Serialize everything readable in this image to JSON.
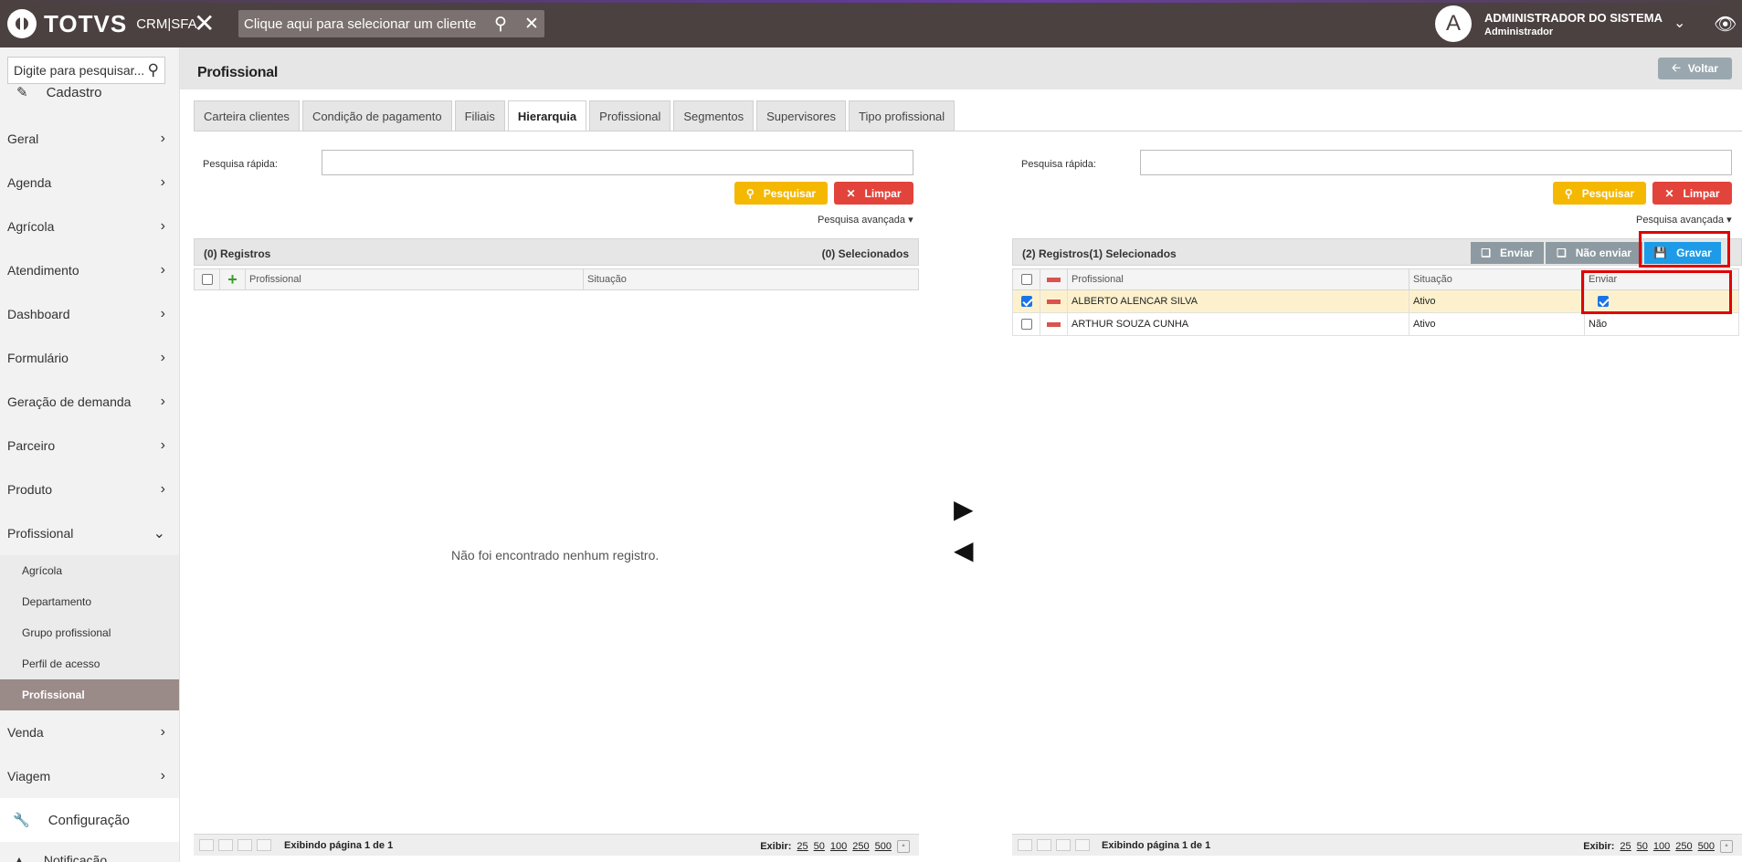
{
  "topbar": {
    "brand": "TOTVS",
    "brand_sub": "CRM|SFA",
    "client_placeholder": "Clique aqui para selecionar um cliente",
    "user_initial": "A",
    "user_name": "ADMINISTRADOR DO SISTEMA",
    "user_role": "Administrador"
  },
  "sidebar": {
    "search_placeholder": "Digite para pesquisar...",
    "cadastro": "Cadastro",
    "items": [
      "Geral",
      "Agenda",
      "Agrícola",
      "Atendimento",
      "Dashboard",
      "Formulário",
      "Geração de demanda",
      "Parceiro",
      "Produto"
    ],
    "expanded": "Profissional",
    "subitems": [
      "Agrícola",
      "Departamento",
      "Grupo profissional",
      "Perfil de acesso",
      "Profissional"
    ],
    "active_subitem": "Profissional",
    "after_items": [
      "Venda",
      "Viagem"
    ],
    "config": "Configuração",
    "notif": "Notificação"
  },
  "page": {
    "title": "Profissional",
    "back_label": "Voltar",
    "tabs": [
      "Carteira clientes",
      "Condição de pagamento",
      "Filiais",
      "Hierarquia",
      "Profissional",
      "Segmentos",
      "Supervisores",
      "Tipo profissional"
    ],
    "active_tab": "Hierarquia"
  },
  "left": {
    "quick_search_label": "Pesquisa rápida:",
    "search_btn": "Pesquisar",
    "clear_btn": "Limpar",
    "advanced": "Pesquisa avançada",
    "header_left": "(0) Registros",
    "header_right": "(0) Selecionados",
    "columns": [
      "Profissional",
      "Situação"
    ],
    "empty": "Não foi encontrado nenhum registro.",
    "footer_page": "Exibindo página 1 de 1",
    "footer_show": "Exibir:",
    "page_sizes": [
      "25",
      "50",
      "100",
      "250",
      "500"
    ]
  },
  "right": {
    "quick_search_label": "Pesquisa rápida:",
    "search_btn": "Pesquisar",
    "clear_btn": "Limpar",
    "advanced": "Pesquisa avançada",
    "header_left": "(2) Registros(1) Selecionados",
    "btn_enviar": "Enviar",
    "btn_nao_enviar": "Não enviar",
    "btn_gravar": "Gravar",
    "columns": [
      "Profissional",
      "Situação",
      "Enviar"
    ],
    "rows": [
      {
        "name": "ALBERTO ALENCAR SILVA",
        "status": "Ativo",
        "enviar": "",
        "selected": true
      },
      {
        "name": "ARTHUR SOUZA CUNHA",
        "status": "Ativo",
        "enviar": "Não",
        "selected": false
      }
    ],
    "footer_page": "Exibindo página 1 de 1",
    "footer_show": "Exibir:",
    "page_sizes": [
      "25",
      "50",
      "100",
      "250",
      "500"
    ]
  },
  "colors": {
    "topbar": "#4b4140",
    "yellow": "#f5b800",
    "red": "#e2443b",
    "blue": "#1e9be8",
    "highlight": "#e00000"
  }
}
